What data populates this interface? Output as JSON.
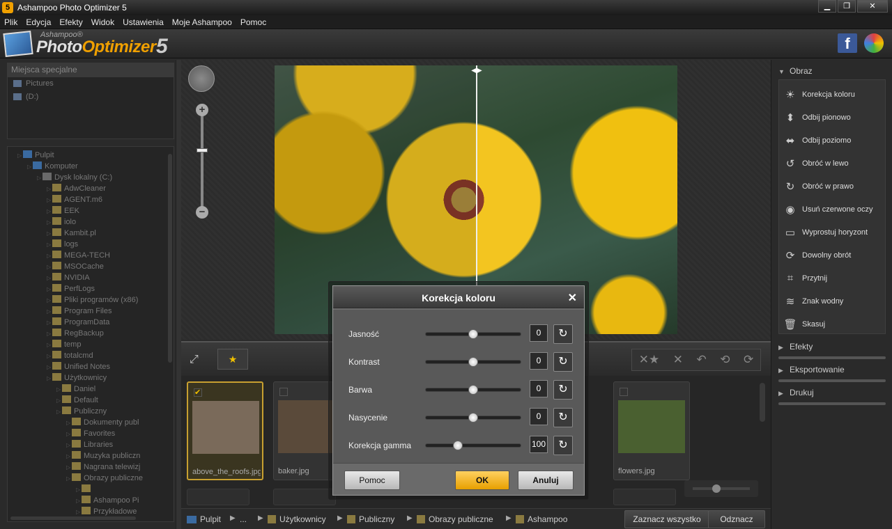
{
  "window": {
    "title": "Ashampoo Photo Optimizer 5",
    "app_icon": "5",
    "minimize": "▁",
    "maximize": "❐",
    "close": "✕"
  },
  "menu": [
    "Plik",
    "Edycja",
    "Efekty",
    "Widok",
    "Ustawienia",
    "Moje Ashampoo",
    "Pomoc"
  ],
  "logo": {
    "small": "Ashampoo®",
    "photo": "Photo",
    "optimizer": "Optimizer",
    "version": "5"
  },
  "left": {
    "special_title": "Miejsca specjalne",
    "special_items": [
      "Pictures",
      "(D:)"
    ],
    "tree": [
      {
        "label": "Pulpit",
        "indent": 0,
        "type": "monitor"
      },
      {
        "label": "Komputer",
        "indent": 1,
        "type": "pc"
      },
      {
        "label": "Dysk lokalny (C:)",
        "indent": 2,
        "type": "disk"
      },
      {
        "label": "AdwCleaner",
        "indent": 3,
        "type": "folder"
      },
      {
        "label": "AGENT.m6",
        "indent": 3,
        "type": "folder"
      },
      {
        "label": "EEK",
        "indent": 3,
        "type": "folder"
      },
      {
        "label": "iolo",
        "indent": 3,
        "type": "folder"
      },
      {
        "label": "Kambit.pl",
        "indent": 3,
        "type": "folder"
      },
      {
        "label": "logs",
        "indent": 3,
        "type": "folder"
      },
      {
        "label": "MEGA-TECH",
        "indent": 3,
        "type": "folder"
      },
      {
        "label": "MSOCache",
        "indent": 3,
        "type": "folder"
      },
      {
        "label": "NVIDIA",
        "indent": 3,
        "type": "folder"
      },
      {
        "label": "PerfLogs",
        "indent": 3,
        "type": "folder"
      },
      {
        "label": "Pliki programów (x86)",
        "indent": 3,
        "type": "folder"
      },
      {
        "label": "Program Files",
        "indent": 3,
        "type": "folder"
      },
      {
        "label": "ProgramData",
        "indent": 3,
        "type": "folder"
      },
      {
        "label": "RegBackup",
        "indent": 3,
        "type": "folder"
      },
      {
        "label": "temp",
        "indent": 3,
        "type": "folder"
      },
      {
        "label": "totalcmd",
        "indent": 3,
        "type": "folder"
      },
      {
        "label": "Unified Notes",
        "indent": 3,
        "type": "folder"
      },
      {
        "label": "Użytkownicy",
        "indent": 3,
        "type": "folder"
      },
      {
        "label": "Daniel",
        "indent": 4,
        "type": "folder"
      },
      {
        "label": "Default",
        "indent": 4,
        "type": "folder"
      },
      {
        "label": "Publiczny",
        "indent": 4,
        "type": "folder"
      },
      {
        "label": "Dokumenty publ",
        "indent": 5,
        "type": "folder"
      },
      {
        "label": "Favorites",
        "indent": 5,
        "type": "folder"
      },
      {
        "label": "Libraries",
        "indent": 5,
        "type": "folder"
      },
      {
        "label": "Muzyka publiczn",
        "indent": 5,
        "type": "folder"
      },
      {
        "label": "Nagrana telewizj",
        "indent": 5,
        "type": "folder"
      },
      {
        "label": "Obrazy publiczne",
        "indent": 5,
        "type": "folder"
      },
      {
        "label": "",
        "indent": 6,
        "type": "folder"
      },
      {
        "label": "Ashampoo Pi",
        "indent": 6,
        "type": "folder"
      },
      {
        "label": "Przykładowe",
        "indent": 6,
        "type": "folder"
      }
    ]
  },
  "viewer": {
    "zoom_plus": "+",
    "zoom_minus": "−",
    "split_handle": "◀▶",
    "zoom_level": 0.38
  },
  "midbar": {
    "expand": "⤢",
    "rate": "★"
  },
  "actions": [
    "✕★",
    "✕",
    "↶",
    "⟲",
    "⟳"
  ],
  "thumbnails": [
    {
      "label": "above_the_roofs.jpg",
      "selected": true,
      "checked": "✔",
      "color": "#7a6a5a"
    },
    {
      "label": "baker.jpg",
      "selected": false,
      "checked": "",
      "color": "#5a4a3a"
    },
    {
      "label": "flowers.jpg",
      "selected": false,
      "checked": "",
      "color": "#4a6030"
    }
  ],
  "thumb_size": 0.42,
  "status": {
    "crumbs": [
      "Pulpit",
      "...",
      "Użytkownicy",
      "Publiczny",
      "Obrazy publiczne",
      "Ashampoo"
    ],
    "select_all": "Zaznacz wszystko",
    "deselect": "Odznacz"
  },
  "right": {
    "sections": {
      "image": "Obraz",
      "effects": "Efekty",
      "export": "Eksportowanie",
      "print": "Drukuj"
    },
    "tools": [
      {
        "label": "Korekcja koloru",
        "icon": "☀"
      },
      {
        "label": "Odbij pionowo",
        "icon": "⬍"
      },
      {
        "label": "Odbij poziomo",
        "icon": "⬌"
      },
      {
        "label": "Obróć w lewo",
        "icon": "↺"
      },
      {
        "label": "Obróć w prawo",
        "icon": "↻"
      },
      {
        "label": "Usuń czerwone oczy",
        "icon": "◉"
      },
      {
        "label": "Wyprostuj horyzont",
        "icon": "▭"
      },
      {
        "label": "Dowolny obrót",
        "icon": "⟳"
      },
      {
        "label": "Przytnij",
        "icon": "⌗"
      },
      {
        "label": "Znak wodny",
        "icon": "≋"
      },
      {
        "label": "Skasuj",
        "icon": "🗑"
      }
    ]
  },
  "dialog": {
    "title": "Korekcja koloru",
    "close": "✕",
    "rows": [
      {
        "label": "Jasność",
        "value": "0",
        "pos": 0.5
      },
      {
        "label": "Kontrast",
        "value": "0",
        "pos": 0.5
      },
      {
        "label": "Barwa",
        "value": "0",
        "pos": 0.5
      },
      {
        "label": "Nasycenie",
        "value": "0",
        "pos": 0.5
      },
      {
        "label": "Korekcja gamma",
        "value": "100",
        "pos": 0.34
      }
    ],
    "reset": "↻",
    "help": "Pomoc",
    "ok": "OK",
    "cancel": "Anuluj"
  }
}
